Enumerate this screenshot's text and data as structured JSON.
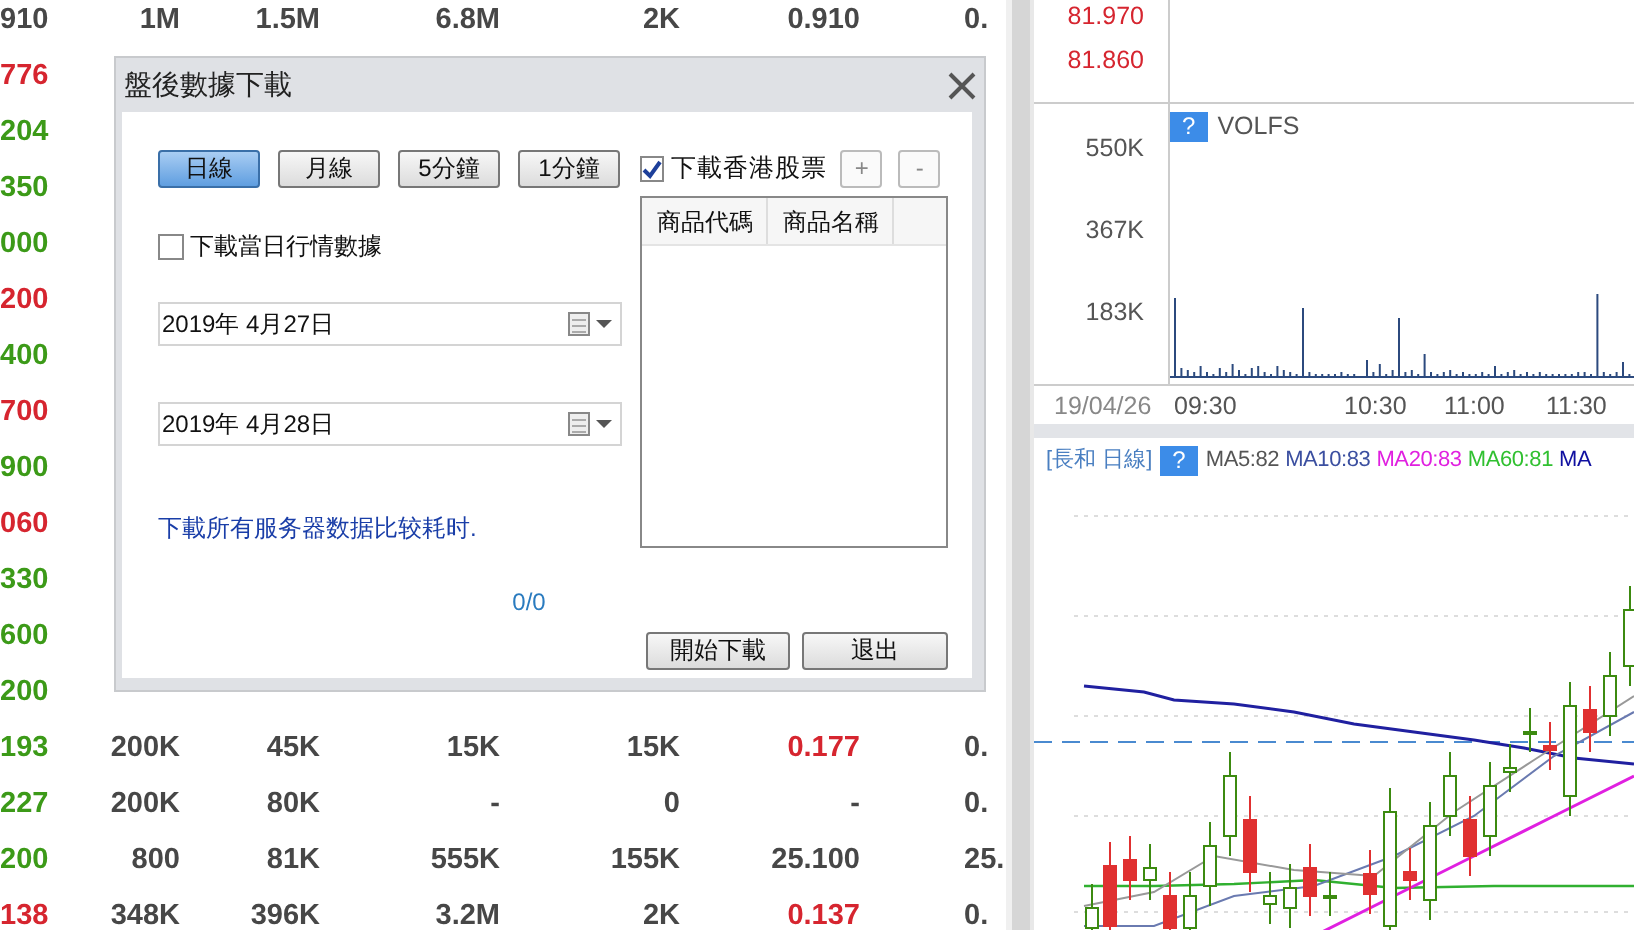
{
  "table": {
    "rows": [
      {
        "cells": [
          {
            "text": "910",
            "color": "#474747"
          },
          {
            "text": "1M",
            "color": "#474747"
          },
          {
            "text": "1.5M",
            "color": "#474747"
          },
          {
            "text": "6.8M",
            "color": "#474747"
          },
          {
            "text": "2K",
            "color": "#474747"
          },
          {
            "text": "0.910",
            "color": "#474747"
          },
          {
            "text": "0.",
            "color": "#474747"
          }
        ]
      },
      {
        "cells": [
          {
            "text": "776",
            "color": "#d6252f"
          }
        ]
      },
      {
        "cells": [
          {
            "text": "204",
            "color": "#3c9a18"
          }
        ]
      },
      {
        "cells": [
          {
            "text": "350",
            "color": "#3c9a18"
          }
        ]
      },
      {
        "cells": [
          {
            "text": "000",
            "color": "#3c9a18"
          }
        ]
      },
      {
        "cells": [
          {
            "text": "200",
            "color": "#d6252f"
          }
        ]
      },
      {
        "cells": [
          {
            "text": "400",
            "color": "#3c9a18"
          }
        ]
      },
      {
        "cells": [
          {
            "text": "700",
            "color": "#d6252f"
          }
        ]
      },
      {
        "cells": [
          {
            "text": "900",
            "color": "#3c9a18"
          }
        ]
      },
      {
        "cells": [
          {
            "text": "060",
            "color": "#d6252f"
          }
        ]
      },
      {
        "cells": [
          {
            "text": "330",
            "color": "#3c9a18"
          }
        ]
      },
      {
        "cells": [
          {
            "text": "600",
            "color": "#3c9a18"
          }
        ]
      },
      {
        "cells": [
          {
            "text": "200",
            "color": "#3c9a18"
          }
        ]
      },
      {
        "cells": [
          {
            "text": "193",
            "color": "#3c9a18"
          },
          {
            "text": "200K",
            "color": "#474747"
          },
          {
            "text": "45K",
            "color": "#474747"
          },
          {
            "text": "15K",
            "color": "#474747"
          },
          {
            "text": "15K",
            "color": "#474747"
          },
          {
            "text": "0.177",
            "color": "#d6252f"
          },
          {
            "text": "0.",
            "color": "#474747"
          }
        ]
      },
      {
        "cells": [
          {
            "text": "227",
            "color": "#3c9a18"
          },
          {
            "text": "200K",
            "color": "#474747"
          },
          {
            "text": "80K",
            "color": "#474747"
          },
          {
            "text": "-",
            "color": "#474747"
          },
          {
            "text": "0",
            "color": "#474747"
          },
          {
            "text": "-",
            "color": "#474747"
          },
          {
            "text": "0.",
            "color": "#474747"
          }
        ]
      },
      {
        "cells": [
          {
            "text": "200",
            "color": "#3c9a18"
          },
          {
            "text": "800",
            "color": "#474747"
          },
          {
            "text": "81K",
            "color": "#474747"
          },
          {
            "text": "555K",
            "color": "#474747"
          },
          {
            "text": "155K",
            "color": "#474747"
          },
          {
            "text": "25.100",
            "color": "#474747"
          },
          {
            "text": "25.",
            "color": "#474747"
          }
        ]
      },
      {
        "cells": [
          {
            "text": "138",
            "color": "#d6252f"
          },
          {
            "text": "348K",
            "color": "#474747"
          },
          {
            "text": "396K",
            "color": "#474747"
          },
          {
            "text": "3.2M",
            "color": "#474747"
          },
          {
            "text": "2K",
            "color": "#474747"
          },
          {
            "text": "0.137",
            "color": "#d6252f"
          },
          {
            "text": "0.",
            "color": "#474747"
          }
        ]
      }
    ]
  },
  "chart_panel": {
    "price_axis": [
      "81.970",
      "81.860"
    ],
    "volume_pane": {
      "badge": "?",
      "title": "VOLFS",
      "y_labels": [
        "550K",
        "367K",
        "183K"
      ]
    },
    "time_axis": [
      "19/04/26",
      "09:30",
      "10:30",
      "11:00",
      "11:30"
    ],
    "kline_pane": {
      "title": "[長和 日線]",
      "badge": "?",
      "ma": [
        {
          "text": "MA5:82",
          "color": "#555555"
        },
        {
          "text": "MA10:83",
          "color": "#3b4fa0"
        },
        {
          "text": "MA20:83",
          "color": "#e020e0"
        },
        {
          "text": "MA60:81",
          "color": "#30c030"
        },
        {
          "text": "MA",
          "color": "#1010a0"
        }
      ]
    }
  },
  "dialog": {
    "title": "盤後數據下載",
    "periods": [
      {
        "label": "日線",
        "selected": true
      },
      {
        "label": "月線",
        "selected": false
      },
      {
        "label": "5分鐘",
        "selected": false
      },
      {
        "label": "1分鐘",
        "selected": false
      }
    ],
    "hk_checkbox": {
      "label": "下載香港股票",
      "checked": true
    },
    "add_button": "+",
    "remove_button": "-",
    "list": {
      "columns": [
        "商品代碼",
        "商品名稱"
      ]
    },
    "today_checkbox": {
      "label": "下載當日行情數據",
      "checked": false
    },
    "date_from": "2019年  4月27日",
    "date_to": "2019年  4月28日",
    "note": "下載所有服务器数据比较耗时.",
    "progress": "0/0",
    "buttons": [
      "開始下載",
      "退出"
    ]
  }
}
